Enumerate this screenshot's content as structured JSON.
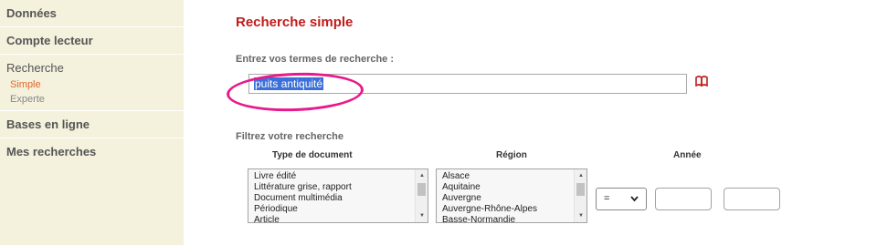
{
  "sidebar": {
    "items": [
      {
        "label": "Données"
      },
      {
        "label": "Compte lecteur"
      },
      {
        "label": "Recherche",
        "subitems": [
          "Simple",
          "Experte"
        ]
      },
      {
        "label": "Bases en ligne"
      },
      {
        "label": "Mes recherches"
      }
    ],
    "active_subitem": "Simple"
  },
  "main": {
    "title": "Recherche simple",
    "search_label": "Entrez vos termes de recherche :",
    "search_value": "puits antiquité",
    "filter_label": "Filtrez votre recherche",
    "columns": {
      "type": "Type de document",
      "region": "Région",
      "year": "Année"
    },
    "type_options": [
      "Livre édité",
      "Littérature grise, rapport",
      "Document multimédia",
      "Périodique",
      "Article"
    ],
    "region_options": [
      "Alsace",
      "Aquitaine",
      "Auvergne",
      "Auvergne-Rhône-Alpes",
      "Basse-Normandie"
    ],
    "year_operator": "="
  },
  "colors": {
    "accent": "#c11b1b",
    "active_nav": "#e0682a",
    "annotation": "#e8198b",
    "sidebar_bg": "#f4f1dd"
  },
  "icons": {
    "dictionary": "book-icon",
    "dropdown": "chevron-down-icon"
  }
}
